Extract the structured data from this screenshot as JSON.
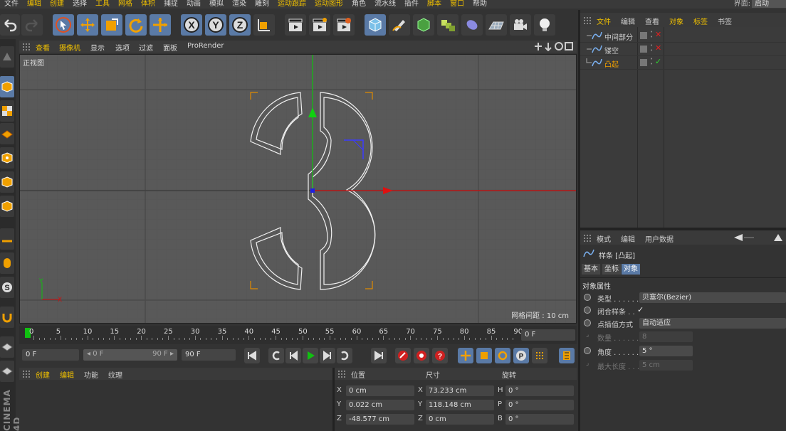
{
  "menubar": {
    "items": [
      "文件",
      "编辑",
      "创建",
      "选择",
      "工具",
      "网格",
      "体积",
      "捕捉",
      "动画",
      "模拟",
      "渲染",
      "雕刻",
      "运动跟踪",
      "运动图形",
      "角色",
      "流水线",
      "插件",
      "脚本",
      "窗口",
      "帮助"
    ],
    "layout_label": "界面:",
    "layout_value": "启动"
  },
  "viewport": {
    "menu": [
      "查看",
      "摄像机",
      "显示",
      "选项",
      "过滤",
      "面板",
      "ProRender"
    ],
    "view_name": "正视图",
    "grid_spacing": "网格间距 : 10 cm",
    "axis_y": "Y",
    "axis_x": "X"
  },
  "timeline": {
    "ticks": [
      "0",
      "5",
      "10",
      "15",
      "20",
      "25",
      "30",
      "35",
      "40",
      "45",
      "50",
      "55",
      "60",
      "65",
      "70",
      "75",
      "80",
      "85",
      "90"
    ],
    "current_frame": "0 F"
  },
  "transport": {
    "start_field": "0 F",
    "range_start": "◂ 0 F",
    "range_end": "90 F ▸",
    "end_field": "90 F"
  },
  "material_panel": {
    "menu": [
      "创建",
      "编辑",
      "功能",
      "纹理"
    ]
  },
  "coordinates": {
    "headers": [
      "位置",
      "尺寸",
      "旋转"
    ],
    "rows": [
      {
        "pos_axis": "X",
        "pos": "0 cm",
        "size_axis": "X",
        "size": "73.233 cm",
        "rot_axis": "H",
        "rot": "0 °"
      },
      {
        "pos_axis": "Y",
        "pos": "0.022 cm",
        "size_axis": "Y",
        "size": "118.148 cm",
        "rot_axis": "P",
        "rot": "0 °"
      },
      {
        "pos_axis": "Z",
        "pos": "-48.577 cm",
        "size_axis": "Z",
        "size": "0 cm",
        "rot_axis": "B",
        "rot": "0 °"
      }
    ]
  },
  "object_manager": {
    "menu": [
      "文件",
      "编辑",
      "查看",
      "对象",
      "标签",
      "书签"
    ],
    "objects": [
      {
        "name": "中间部分",
        "status": "✕"
      },
      {
        "name": "镂空",
        "status": "✕"
      },
      {
        "name": "凸起",
        "status": "✓"
      }
    ]
  },
  "attribute_manager": {
    "menu": [
      "模式",
      "编辑",
      "用户数据"
    ],
    "object_title": "样条 [凸起]",
    "tabs": [
      "基本",
      "坐标",
      "对象"
    ],
    "section": "对象属性",
    "props": [
      {
        "label": "类型 . . . . . . .",
        "value": "贝塞尔(Bezier)",
        "enabled": true
      },
      {
        "label": "闭合样条 . .",
        "value": "✓",
        "enabled": true
      },
      {
        "label": "点插值方式",
        "value": "自动适应",
        "enabled": true
      },
      {
        "label": "数量 . . . . . . .",
        "value": "8",
        "enabled": false
      },
      {
        "label": "角度 . . . . . . .",
        "value": "5 °",
        "enabled": true
      },
      {
        "label": "最大长度 . . .",
        "value": "5 cm",
        "enabled": false
      }
    ]
  },
  "brand": {
    "text": "CINEMA 4D"
  },
  "colors": {
    "accent_blue": "#5a7aa6",
    "highlight_yellow": "#f0c000",
    "axis_red": "#e01010",
    "axis_green": "#10c010",
    "selection_orange": "#e08a00"
  }
}
